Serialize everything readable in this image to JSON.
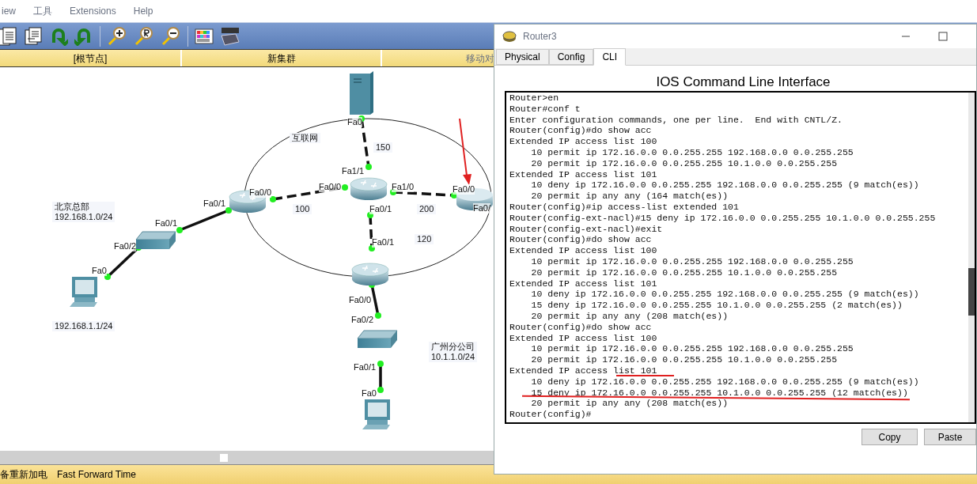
{
  "menu": [
    "iew",
    "工具",
    "Extensions",
    "Help"
  ],
  "breadcrumb_bar": [
    "[根节点]",
    "新集群",
    "移动对"
  ],
  "topology": {
    "notes": [
      {
        "lines": [
          "互联网"
        ]
      },
      {
        "lines": [
          "150"
        ]
      },
      {
        "lines": [
          "100"
        ]
      },
      {
        "lines": [
          "200"
        ]
      },
      {
        "lines": [
          "120"
        ]
      },
      {
        "lines": [
          "北京总部",
          "192.168.1.0/24"
        ]
      },
      {
        "lines": [
          "192.168.1.1/24"
        ]
      },
      {
        "lines": [
          "广州分公司",
          "10.1.1.0/24"
        ]
      }
    ],
    "ports": [
      "Fa0",
      "Fa1/1",
      "Fa0/0",
      "Fa0/0",
      "Fa1/0",
      "Fa0/0",
      "Fa0/",
      "Fa0/1",
      "Fa0/1",
      "Fa0/1",
      "Fa0/1",
      "Fa0/2",
      "Fa0",
      "Fa0/0",
      "Fa0/2",
      "Fa0/1",
      "Fa0"
    ]
  },
  "status_bar": {
    "action": "备重新加电",
    "mode": "Fast Forward Time"
  },
  "dialog": {
    "title": "Router3",
    "tabs": [
      {
        "label": "Physical",
        "selected": false
      },
      {
        "label": "Config",
        "selected": false
      },
      {
        "label": "CLI",
        "selected": true
      }
    ],
    "heading": "IOS Command Line Interface",
    "cli_lines": [
      {
        "text": "Router>en"
      },
      {
        "text": "Router#conf t"
      },
      {
        "text": "Enter configuration commands, one per line.  End with CNTL/Z."
      },
      {
        "text": "Router(config)#do show acc"
      },
      {
        "text": "Extended IP access list 100"
      },
      {
        "text": "    10 permit ip 172.16.0.0 0.0.255.255 192.168.0.0 0.0.255.255"
      },
      {
        "text": "    20 permit ip 172.16.0.0 0.0.255.255 10.1.0.0 0.0.255.255"
      },
      {
        "text": "Extended IP access list 101"
      },
      {
        "text": "    10 deny ip 172.16.0.0 0.0.255.255 192.168.0.0 0.0.255.255 (9 match(es))"
      },
      {
        "text": "    20 permit ip any any (164 match(es))"
      },
      {
        "text": "Router(config)#ip access-list extended 101"
      },
      {
        "text": "Router(config-ext-nacl)#15 deny ip 172.16.0.0 0.0.255.255 10.1.0.0 0.0.255.255"
      },
      {
        "text": "Router(config-ext-nacl)#exit"
      },
      {
        "text": "Router(config)#do show acc"
      },
      {
        "text": "Extended IP access list 100"
      },
      {
        "text": "    10 permit ip 172.16.0.0 0.0.255.255 192.168.0.0 0.0.255.255"
      },
      {
        "text": "    20 permit ip 172.16.0.0 0.0.255.255 10.1.0.0 0.0.255.255"
      },
      {
        "text": "Extended IP access list 101"
      },
      {
        "text": "    10 deny ip 172.16.0.0 0.0.255.255 192.168.0.0 0.0.255.255 (9 match(es))"
      },
      {
        "text": "    15 deny ip 172.16.0.0 0.0.255.255 10.1.0.0 0.0.255.255 (2 match(es))"
      },
      {
        "text": "    20 permit ip any any (208 match(es))"
      },
      {
        "text": "Router(config)#do show acc"
      },
      {
        "text": "Extended IP access list 100"
      },
      {
        "text": "    10 permit ip 172.16.0.0 0.0.255.255 192.168.0.0 0.0.255.255"
      },
      {
        "text": "    20 permit ip 172.16.0.0 0.0.255.255 10.1.0.0 0.0.255.255"
      },
      {
        "text": "Extended IP access list 101",
        "underline_partial": true
      },
      {
        "text": "    10 deny ip 172.16.0.0 0.0.255.255 192.168.0.0 0.0.255.255 (9 match(es))"
      },
      {
        "text": "    15 deny ip 172.16.0.0 0.0.255.255 10.1.0.0 0.0.255.255 (12 match(es))",
        "underline_full": true
      },
      {
        "text": "    20 permit ip any any (208 match(es))"
      },
      {
        "text": "Router(config)#"
      }
    ],
    "buttons": [
      "Copy",
      "Paste"
    ]
  }
}
